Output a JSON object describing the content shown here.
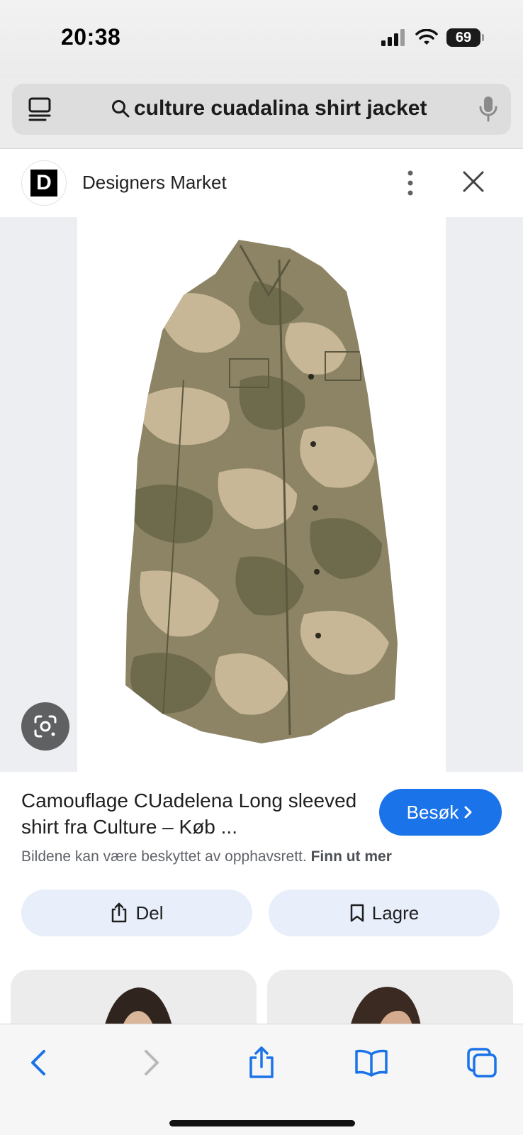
{
  "status_bar": {
    "time": "20:38",
    "battery": "69"
  },
  "search": {
    "query": "culture cuadalina shirt jacket"
  },
  "source": {
    "logo_letter": "D",
    "name": "Designers Market"
  },
  "result": {
    "title": "Camouflage CUadelena Long sleeved shirt fra Culture – Køb ...",
    "visit_label": "Besøk",
    "copyright_text": "Bildene kan være beskyttet av opphavsrett.",
    "copyright_link": "Finn ut mer"
  },
  "actions": {
    "share_label": "Del",
    "save_label": "Lagre"
  },
  "colors": {
    "accent": "#1a73e8",
    "action_button_bg": "#e8effb",
    "camo_base": "#8c8465",
    "camo_light": "#c7b796",
    "camo_dark": "#6e6a4c"
  }
}
